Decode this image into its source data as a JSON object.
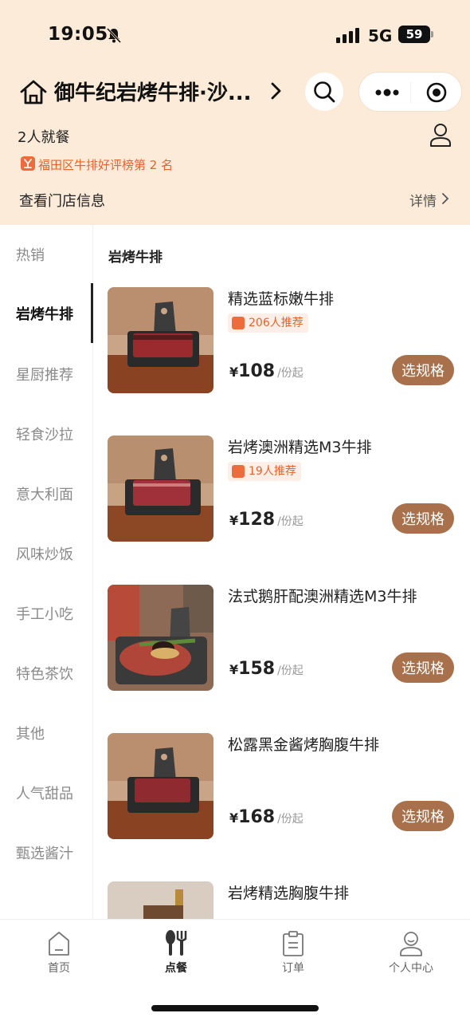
{
  "status_bar": {
    "time": "19:05",
    "network": "5G",
    "battery": "59"
  },
  "header": {
    "store_name": "御牛纪岩烤牛排·沙...",
    "diners": "2人就餐",
    "ranking": "福田区牛排好评榜第 2 名",
    "store_info": "查看门店信息",
    "details": "详情"
  },
  "sidebar": {
    "items": [
      {
        "label": "热销"
      },
      {
        "label": "岩烤牛排"
      },
      {
        "label": "星厨推荐"
      },
      {
        "label": "轻食沙拉"
      },
      {
        "label": "意大利面"
      },
      {
        "label": "风味炒饭"
      },
      {
        "label": "手工小吃"
      },
      {
        "label": "特色茶饮"
      },
      {
        "label": "其他"
      },
      {
        "label": "人气甜品"
      },
      {
        "label": "甄选酱汁"
      }
    ],
    "active": "岩烤牛排"
  },
  "section_title": "岩烤牛排",
  "products": [
    {
      "name": "精选蓝标嫩牛排",
      "recommend": "206人推荐",
      "currency": "¥",
      "price": "108",
      "unit": "/份起",
      "button": "选规格"
    },
    {
      "name": "岩烤澳洲精选M3牛排",
      "recommend": "19人推荐",
      "currency": "¥",
      "price": "128",
      "unit": "/份起",
      "button": "选规格"
    },
    {
      "name": "法式鹅肝配澳洲精选M3牛排",
      "recommend": "",
      "currency": "¥",
      "price": "158",
      "unit": "/份起",
      "button": "选规格"
    },
    {
      "name": "松露黑金酱烤胸腹牛排",
      "recommend": "",
      "currency": "¥",
      "price": "168",
      "unit": "/份起",
      "button": "选规格"
    },
    {
      "name": "岩烤精选胸腹牛排",
      "recommend": "",
      "currency": "",
      "price": "",
      "unit": "",
      "button": ""
    }
  ],
  "tabbar": {
    "items": [
      {
        "label": "首页",
        "icon": "home-icon"
      },
      {
        "label": "点餐",
        "icon": "utensils-icon"
      },
      {
        "label": "订单",
        "icon": "order-icon"
      },
      {
        "label": "个人中心",
        "icon": "profile-icon"
      }
    ],
    "active": "点餐"
  },
  "colors": {
    "header_bg": "#fcebd8",
    "accent_button": "#a8704b",
    "rank_orange": "#e8622c"
  }
}
